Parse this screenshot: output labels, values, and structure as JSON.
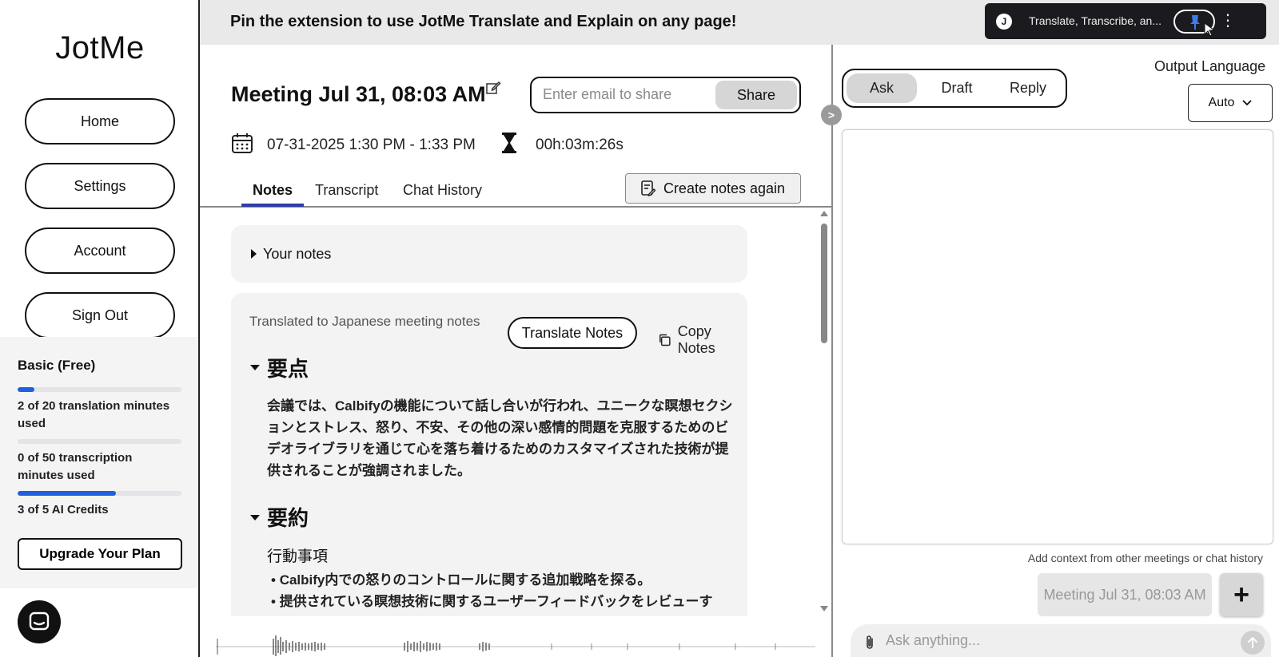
{
  "sidebar": {
    "logo": "JotMe",
    "nav": [
      "Home",
      "Settings",
      "Account",
      "Sign Out"
    ],
    "plan": "Basic (Free)",
    "usage": [
      {
        "label": "2 of 20 translation minutes used",
        "used": 2,
        "total": 20
      },
      {
        "label": "0 of 50 transcription minutes used",
        "used": 0,
        "total": 50
      },
      {
        "label": "3 of 5 AI Credits",
        "used": 3,
        "total": 5
      }
    ],
    "upgrade_label": "Upgrade Your Plan"
  },
  "banner": {
    "text": "Pin the extension to use JotMe Translate and Explain on any page!",
    "extension_label": "Translate, Transcribe, an...",
    "extension_logo": "J"
  },
  "meeting": {
    "title": "Meeting Jul 31, 08:03 AM",
    "share_placeholder": "Enter email to share",
    "share_label": "Share",
    "date_range": "07-31-2025 1:30 PM - 1:33 PM",
    "duration": "00h:03m:26s",
    "tabs": [
      "Notes",
      "Transcript",
      "Chat History"
    ],
    "create_notes_label": "Create notes again"
  },
  "notes": {
    "your_notes_label": "Your notes",
    "translated_label": "Translated to Japanese meeting notes",
    "translate_btn": "Translate Notes",
    "copy_btn": "Copy Notes",
    "section1_title": "要点",
    "section1_lines": [
      "会議では、Calbifyの機能について話し合いが行われ、ユニークな瞑想セクシ",
      "ョンとストレス、怒り、不安、その他の深い感情的問題を克服するためのビ",
      "デオライブラリを通じて心を落ち着けるためのカスタマイズされた技術が提",
      "供されることが強調されました。"
    ],
    "section2_title": "要約",
    "section2_subtitle": "行動事項",
    "bullets": [
      "Calbify内での怒りのコントロールに関する追加戦略を探る。",
      "提供されている瞑想技術に関するユーザーフィードバックをレビューす"
    ]
  },
  "assistant": {
    "modes": [
      "Ask",
      "Draft",
      "Reply"
    ],
    "output_language_label": "Output Language",
    "output_language_value": "Auto",
    "context_label": "Add context from other meetings or chat history",
    "context_chip": "Meeting Jul 31, 08:03 AM",
    "ask_placeholder": "Ask anything..."
  },
  "colors": {
    "accent": "#1f5fe0",
    "tab_underline": "#2e3da8"
  }
}
